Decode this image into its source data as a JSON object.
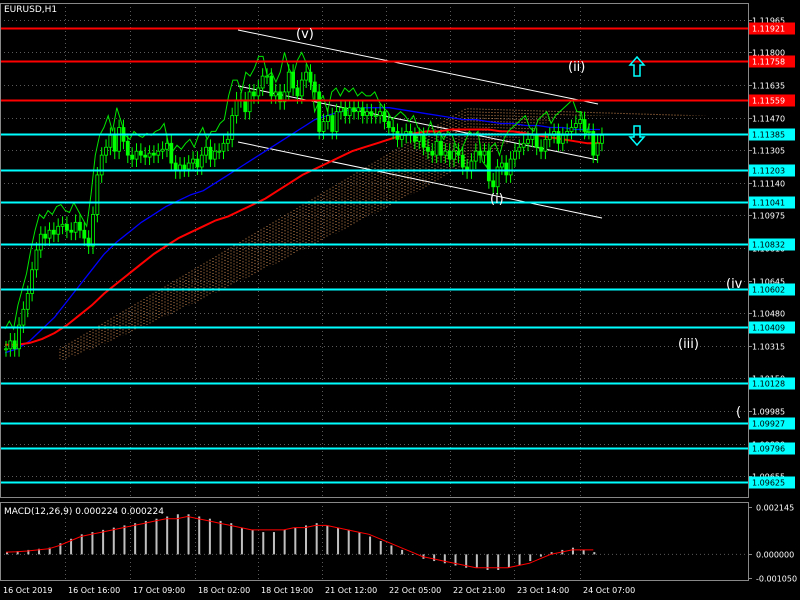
{
  "symbol": "EURUSD,H1",
  "indicator_label": "MACD(12,26,9) 0.000224 0.000224",
  "colors": {
    "background": "#000000",
    "grid": "#5a5a5a",
    "candles": "#00ff00",
    "resistance": "#ff0000",
    "support": "#00ffff",
    "ma_slow": "#ff0000",
    "ma_mid": "#0000ff",
    "kumo": "#f4a460",
    "chikou": "#00ff00",
    "macd_hist": "#c0c0c0",
    "macd_signal": "#ff0000",
    "channel": "#ffffff"
  },
  "chart_data": [
    {
      "type": "line",
      "title": "EURUSD,H1",
      "y_ticks": [
        "1.11965",
        "1.11800",
        "1.11635",
        "1.11470",
        "1.11305",
        "1.11140",
        "1.10975",
        "1.10810",
        "1.10645",
        "1.10480",
        "1.10315",
        "1.10150",
        "1.09985",
        "1.09820",
        "1.09655"
      ],
      "x_ticks": [
        "16 Oct 2019",
        "16 Oct 16:00",
        "17 Oct 09:00",
        "18 Oct 02:00",
        "18 Oct 19:00",
        "21 Oct 12:00",
        "22 Oct 05:00",
        "22 Oct 21:00",
        "23 Oct 14:00",
        "24 Oct 07:00"
      ],
      "ylim": [
        1.0955,
        1.1205
      ],
      "grid": true,
      "levels": [
        {
          "value": 1.11921,
          "label": "1.11921",
          "kind": "resistance"
        },
        {
          "value": 1.11758,
          "label": "1.11758",
          "kind": "resistance"
        },
        {
          "value": 1.11559,
          "label": "1.11559",
          "kind": "resistance"
        },
        {
          "value": 1.11385,
          "label": "1.11385",
          "kind": "support"
        },
        {
          "value": 1.11203,
          "label": "1.11203",
          "kind": "support"
        },
        {
          "value": 1.11041,
          "label": "1.11041",
          "kind": "support"
        },
        {
          "value": 1.10832,
          "label": "1.10832",
          "kind": "support"
        },
        {
          "value": 1.10602,
          "label": "1.10602",
          "kind": "support"
        },
        {
          "value": 1.10409,
          "label": "1.10409",
          "kind": "support"
        },
        {
          "value": 1.10128,
          "label": "1.10128",
          "kind": "support"
        },
        {
          "value": 1.09927,
          "label": "1.09927",
          "kind": "support"
        },
        {
          "value": 1.09796,
          "label": "1.09796",
          "kind": "support"
        },
        {
          "value": 1.09625,
          "label": "1.09625",
          "kind": "support"
        }
      ],
      "close": [
        1.103,
        1.1034,
        1.103,
        1.1042,
        1.105,
        1.1058,
        1.107,
        1.108,
        1.1088,
        1.1086,
        1.109,
        1.1088,
        1.1092,
        1.1093,
        1.109,
        1.1089,
        1.1094,
        1.109,
        1.1086,
        1.1082,
        1.1098,
        1.1118,
        1.1128,
        1.1132,
        1.1138,
        1.113,
        1.1142,
        1.1135,
        1.1128,
        1.1126,
        1.113,
        1.1128,
        1.1127,
        1.1129,
        1.1128,
        1.113,
        1.1131,
        1.1134,
        1.1124,
        1.112,
        1.1123,
        1.1121,
        1.1124,
        1.1126,
        1.1122,
        1.1128,
        1.1132,
        1.1126,
        1.113,
        1.113,
        1.1134,
        1.1136,
        1.1148,
        1.1156,
        1.1156,
        1.115,
        1.116,
        1.1158,
        1.1162,
        1.1168,
        1.1168,
        1.1158,
        1.116,
        1.1155,
        1.116,
        1.117,
        1.1162,
        1.1158,
        1.1166,
        1.117,
        1.1165,
        1.116,
        1.114,
        1.1145,
        1.1148,
        1.114,
        1.115,
        1.1152,
        1.1148,
        1.1152,
        1.115,
        1.1152,
        1.1148,
        1.115,
        1.1148,
        1.1148,
        1.115,
        1.1145,
        1.1142,
        1.114,
        1.1136,
        1.1138,
        1.114,
        1.1138,
        1.1135,
        1.1138,
        1.1132,
        1.113,
        1.1128,
        1.1135,
        1.1128,
        1.113,
        1.1126,
        1.113,
        1.1128,
        1.1122,
        1.112,
        1.1125,
        1.113,
        1.1128,
        1.113,
        1.1115,
        1.1112,
        1.1122,
        1.1124,
        1.1118,
        1.1126,
        1.113,
        1.1132,
        1.1134,
        1.1136,
        1.1138,
        1.1132,
        1.113,
        1.1136,
        1.1138,
        1.114,
        1.1134,
        1.1138,
        1.114,
        1.1142,
        1.1144,
        1.1146,
        1.114,
        1.114,
        1.1128,
        1.1134,
        1.1138
      ],
      "series": [
        {
          "name": "",
          "kind": "ma_slow",
          "values": [
            1.1032,
            1.1032,
            1.1033,
            1.1035,
            1.1038,
            1.1042,
            1.1047,
            1.1052,
            1.1058,
            1.1063,
            1.1068,
            1.1073,
            1.1078,
            1.1082,
            1.1086,
            1.1089,
            1.1092,
            1.1095,
            1.1097,
            1.11,
            1.1103,
            1.1106,
            1.111,
            1.1114,
            1.1118,
            1.1121,
            1.1124,
            1.1127,
            1.113,
            1.1132,
            1.1134,
            1.1136,
            1.1138,
            1.1139,
            1.114,
            1.114,
            1.1141,
            1.1141,
            1.1141,
            1.1141,
            1.114,
            1.114,
            1.1139,
            1.1138,
            1.1137,
            1.1136,
            1.1135,
            1.1134,
            1.1134
          ]
        },
        {
          "name": "",
          "kind": "ma_mid",
          "values": [
            1.1028,
            1.103,
            1.1034,
            1.104,
            1.1046,
            1.1054,
            1.1062,
            1.107,
            1.1078,
            1.1084,
            1.1089,
            1.1094,
            1.1098,
            1.1102,
            1.1105,
            1.1108,
            1.111,
            1.1114,
            1.1118,
            1.1122,
            1.1126,
            1.113,
            1.1134,
            1.1138,
            1.1142,
            1.1146,
            1.1148,
            1.115,
            1.1151,
            1.1152,
            1.1152,
            1.1152,
            1.1151,
            1.115,
            1.1149,
            1.1148,
            1.1147,
            1.1146,
            1.1146,
            1.1145,
            1.1144,
            1.1144,
            1.1143,
            1.1143,
            1.1142,
            1.1142,
            1.1141,
            1.1141,
            1.1141
          ]
        }
      ],
      "annotations": [
        "(v)",
        "(ii)",
        "(i)",
        "(iv",
        "(iii)",
        "( "
      ],
      "arrows": [
        "up",
        "down"
      ]
    },
    {
      "type": "bar",
      "title": "MACD(12,26,9) 0.000224 0.000224",
      "y_ticks": [
        "0.002145",
        "0.000000",
        "-0.001050"
      ],
      "ylim": [
        -0.00115,
        0.00235
      ],
      "values": [
        0.0001,
        0.00015,
        0.0002,
        0.00025,
        0.0003,
        0.0005,
        0.0007,
        0.0009,
        0.001,
        0.0011,
        0.0012,
        0.0013,
        0.0014,
        0.0015,
        0.0016,
        0.0017,
        0.0018,
        0.0018,
        0.0017,
        0.0016,
        0.0015,
        0.0014,
        0.0012,
        0.0011,
        0.001,
        0.001,
        0.0011,
        0.0012,
        0.0013,
        0.0014,
        0.0013,
        0.0012,
        0.0011,
        0.001,
        0.0008,
        0.0006,
        0.0004,
        0.0002,
        0.0,
        -0.0002,
        -0.0003,
        -0.0004,
        -0.0005,
        -0.0006,
        -0.0006,
        -0.0007,
        -0.0007,
        -0.0006,
        -0.0005,
        -0.0003,
        -0.0001,
        0.0001,
        0.0002,
        0.0003,
        0.0002,
        0.0001
      ],
      "signal": [
        0.0001,
        0.00012,
        0.00015,
        0.0002,
        0.00025,
        0.0004,
        0.0006,
        0.0008,
        0.0009,
        0.001,
        0.0011,
        0.0012,
        0.0013,
        0.0014,
        0.0015,
        0.0016,
        0.0016,
        0.0017,
        0.0016,
        0.0015,
        0.0014,
        0.0013,
        0.0012,
        0.0011,
        0.0011,
        0.0011,
        0.0011,
        0.0012,
        0.0012,
        0.0013,
        0.0013,
        0.0012,
        0.0011,
        0.001,
        0.0009,
        0.0007,
        0.0005,
        0.0003,
        0.0001,
        -0.0001,
        -0.0002,
        -0.0003,
        -0.0004,
        -0.0005,
        -0.0006,
        -0.0006,
        -0.0006,
        -0.0006,
        -0.0005,
        -0.0004,
        -0.0002,
        0.0,
        0.0001,
        0.0002,
        0.0002,
        0.0002
      ]
    }
  ]
}
